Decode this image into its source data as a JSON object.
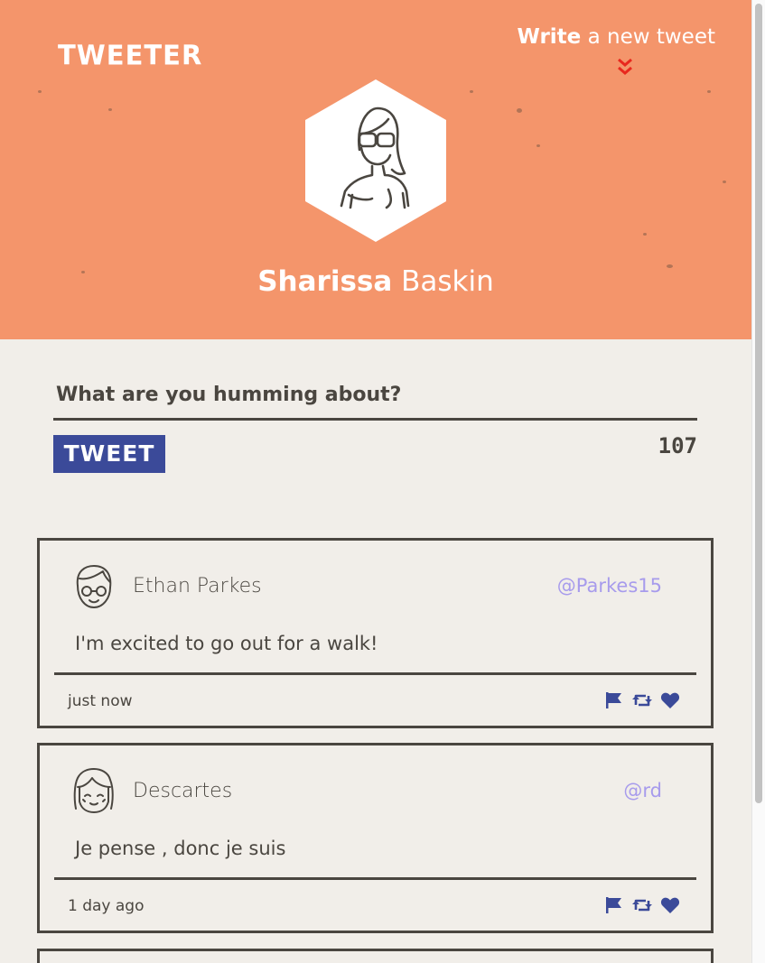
{
  "brand": "TWEETER",
  "compose_link": {
    "bold": "Write",
    "rest": "a new tweet",
    "icon": "double-chevron-down-icon"
  },
  "profile": {
    "first_name": "Sharissa",
    "last_name": "Baskin",
    "avatar_icon": "woman-avatar-icon"
  },
  "compose": {
    "placeholder": "What are you humming about?",
    "button_label": "TWEET",
    "char_count": "107"
  },
  "tweets": [
    {
      "name": "Ethan Parkes",
      "handle": "@Parkes15",
      "text": "I'm excited to go out for a walk!",
      "time": "just now",
      "avatar_icon": "man-with-glasses-avatar-icon"
    },
    {
      "name": "Descartes",
      "handle": "@rd",
      "text": "Je pense , donc je suis",
      "time": "1 day ago",
      "avatar_icon": "girl-with-bangs-avatar-icon"
    }
  ],
  "actions": [
    "flag-icon",
    "retweet-icon",
    "heart-icon"
  ],
  "colors": {
    "header_bg": "#f4956b",
    "page_bg": "#f1eee9",
    "accent_blue": "#3b4a99",
    "handle_purple": "#a79bec",
    "chevron_red": "#e8281e",
    "dark": "#4a4640"
  }
}
